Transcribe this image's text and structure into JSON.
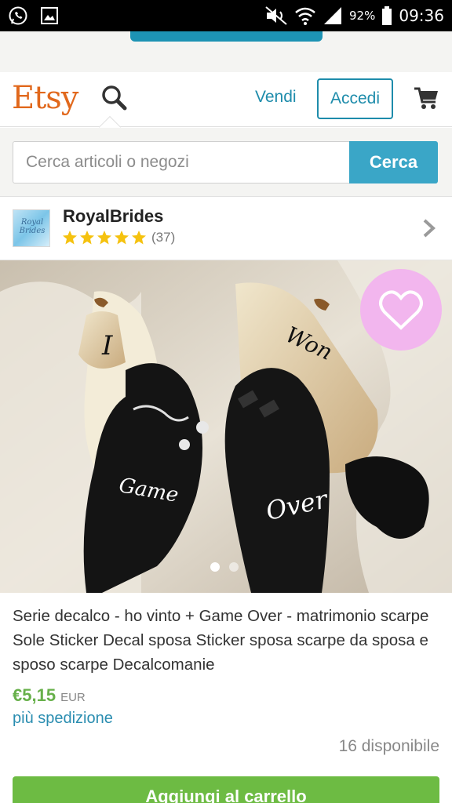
{
  "status_bar": {
    "battery": "92%",
    "time": "09:36"
  },
  "header": {
    "logo": "Etsy",
    "sell_label": "Vendi",
    "signin_label": "Accedi"
  },
  "search": {
    "placeholder": "Cerca articoli o negozi",
    "button_label": "Cerca"
  },
  "shop": {
    "name": "RoyalBrides",
    "avatar_text": "Royal Brides",
    "rating": 5,
    "review_count": "(37)"
  },
  "product": {
    "image_text": {
      "left_heel": "I",
      "right_heel": "Won",
      "left_sole": "Game",
      "right_sole": "Over"
    },
    "carousel": {
      "total": 2,
      "active": 1
    },
    "title": "Serie decalco - ho vinto + Game Over - matrimonio scarpe Sole Sticker Decal sposa Sticker sposa scarpe da sposa e sposo scarpe Decalcomanie",
    "price": "€5,15",
    "currency": "EUR",
    "shipping": "più spedizione",
    "availability": "16 disponibile",
    "add_to_cart_label": "Aggiungi al carrello"
  },
  "colors": {
    "etsy_orange": "#e1681c",
    "link_blue": "#1e8cab",
    "search_button": "#3aa6c7",
    "price_green": "#67b04a",
    "cart_button": "#6dbb43",
    "star_yellow": "#f5c20f"
  }
}
